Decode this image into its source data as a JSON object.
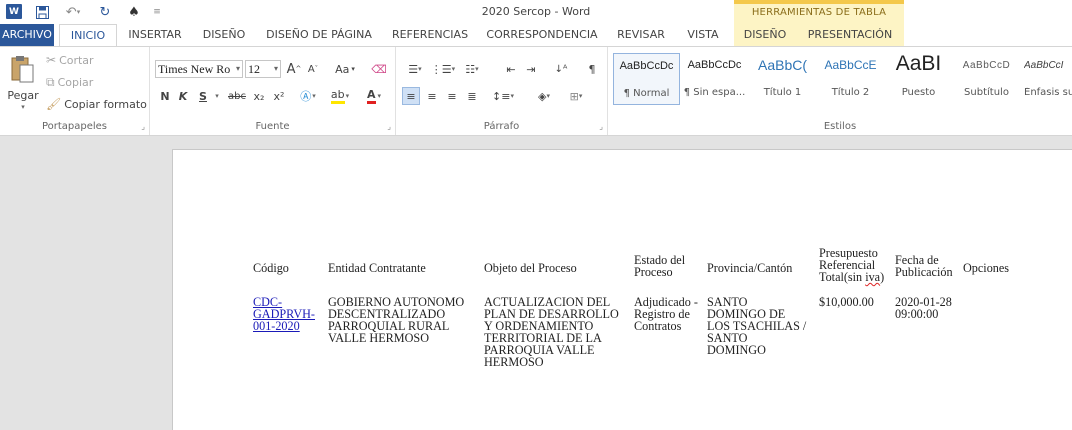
{
  "window": {
    "title": "2020 Sercop - Word",
    "contextual_header": "HERRAMIENTAS DE TABLA"
  },
  "tabs": [
    {
      "label": "ARCHIVO"
    },
    {
      "label": "INICIO"
    },
    {
      "label": "INSERTAR"
    },
    {
      "label": "DISEÑO"
    },
    {
      "label": "DISEÑO DE PÁGINA"
    },
    {
      "label": "REFERENCIAS"
    },
    {
      "label": "CORRESPONDENCIA"
    },
    {
      "label": "REVISAR"
    },
    {
      "label": "VISTA"
    },
    {
      "label": "DISEÑO"
    },
    {
      "label": "PRESENTACIÓN"
    }
  ],
  "ribbon": {
    "clipboard": {
      "label": "Portapapeles",
      "paste": "Pegar",
      "cut": "Cortar",
      "copy": "Copiar",
      "format_painter": "Copiar formato"
    },
    "font": {
      "label": "Fuente",
      "font_name": "Times New Ro",
      "font_size": "12",
      "grow": "A",
      "shrink": "A",
      "case": "Aa",
      "bold": "N",
      "italic": "K",
      "underline": "S",
      "strike": "abc",
      "subscript": "x₂",
      "superscript": "x²",
      "font_color_letter": "A"
    },
    "paragraph": {
      "label": "Párrafo",
      "pilcrow": "¶"
    },
    "styles": {
      "label": "Estilos",
      "items": [
        {
          "sample": "AaBbCcDc",
          "name": "¶ Normal"
        },
        {
          "sample": "AaBbCcDc",
          "name": "¶ Sin espa..."
        },
        {
          "sample": "AaBbC(",
          "name": "Título 1"
        },
        {
          "sample": "AaBbCcE",
          "name": "Título 2"
        },
        {
          "sample": "AaBI",
          "name": "Puesto"
        },
        {
          "sample": "AaBbCcD",
          "name": "Subtítulo"
        },
        {
          "sample": "AaBbCcI",
          "name": "Énfasis su"
        }
      ]
    }
  },
  "table": {
    "headers": {
      "codigo": "Código",
      "entidad": "Entidad Contratante",
      "objeto": "Objeto del Proceso",
      "estado": [
        "Estado del",
        "Proceso"
      ],
      "provincia": "Provincia/Cantón",
      "presupuesto": [
        "Presupuesto",
        "Referencial",
        "Total(sin ",
        "iva",
        ")"
      ],
      "fecha": [
        "Fecha de",
        "Publicación"
      ],
      "opciones": "Opciones"
    },
    "row": {
      "codigo": [
        "CDC-",
        "GADPRVH-",
        "001-2020"
      ],
      "entidad": [
        "GOBIERNO AUTONOMO",
        "DESCENTRALIZADO",
        "PARROQUIAL RURAL",
        "VALLE HERMOSO"
      ],
      "objeto": [
        "ACTUALIZACION DEL",
        "PLAN DE DESARROLLO",
        "Y ORDENAMIENTO",
        "TERRITORIAL DE LA",
        "PARROQUIA VALLE",
        "HERMOSO"
      ],
      "estado": [
        "Adjudicado -",
        "Registro de",
        "Contratos"
      ],
      "provincia": [
        "SANTO",
        "DOMINGO DE",
        "LOS TSACHILAS /",
        "SANTO",
        "DOMINGO"
      ],
      "presupuesto": "$10,000.00",
      "fecha": [
        "2020-01-28",
        "09:00:00"
      ]
    }
  },
  "colors": {
    "accent": "#2b579a",
    "contextual": "#fdf4c5",
    "link": "#1a1ab8"
  }
}
